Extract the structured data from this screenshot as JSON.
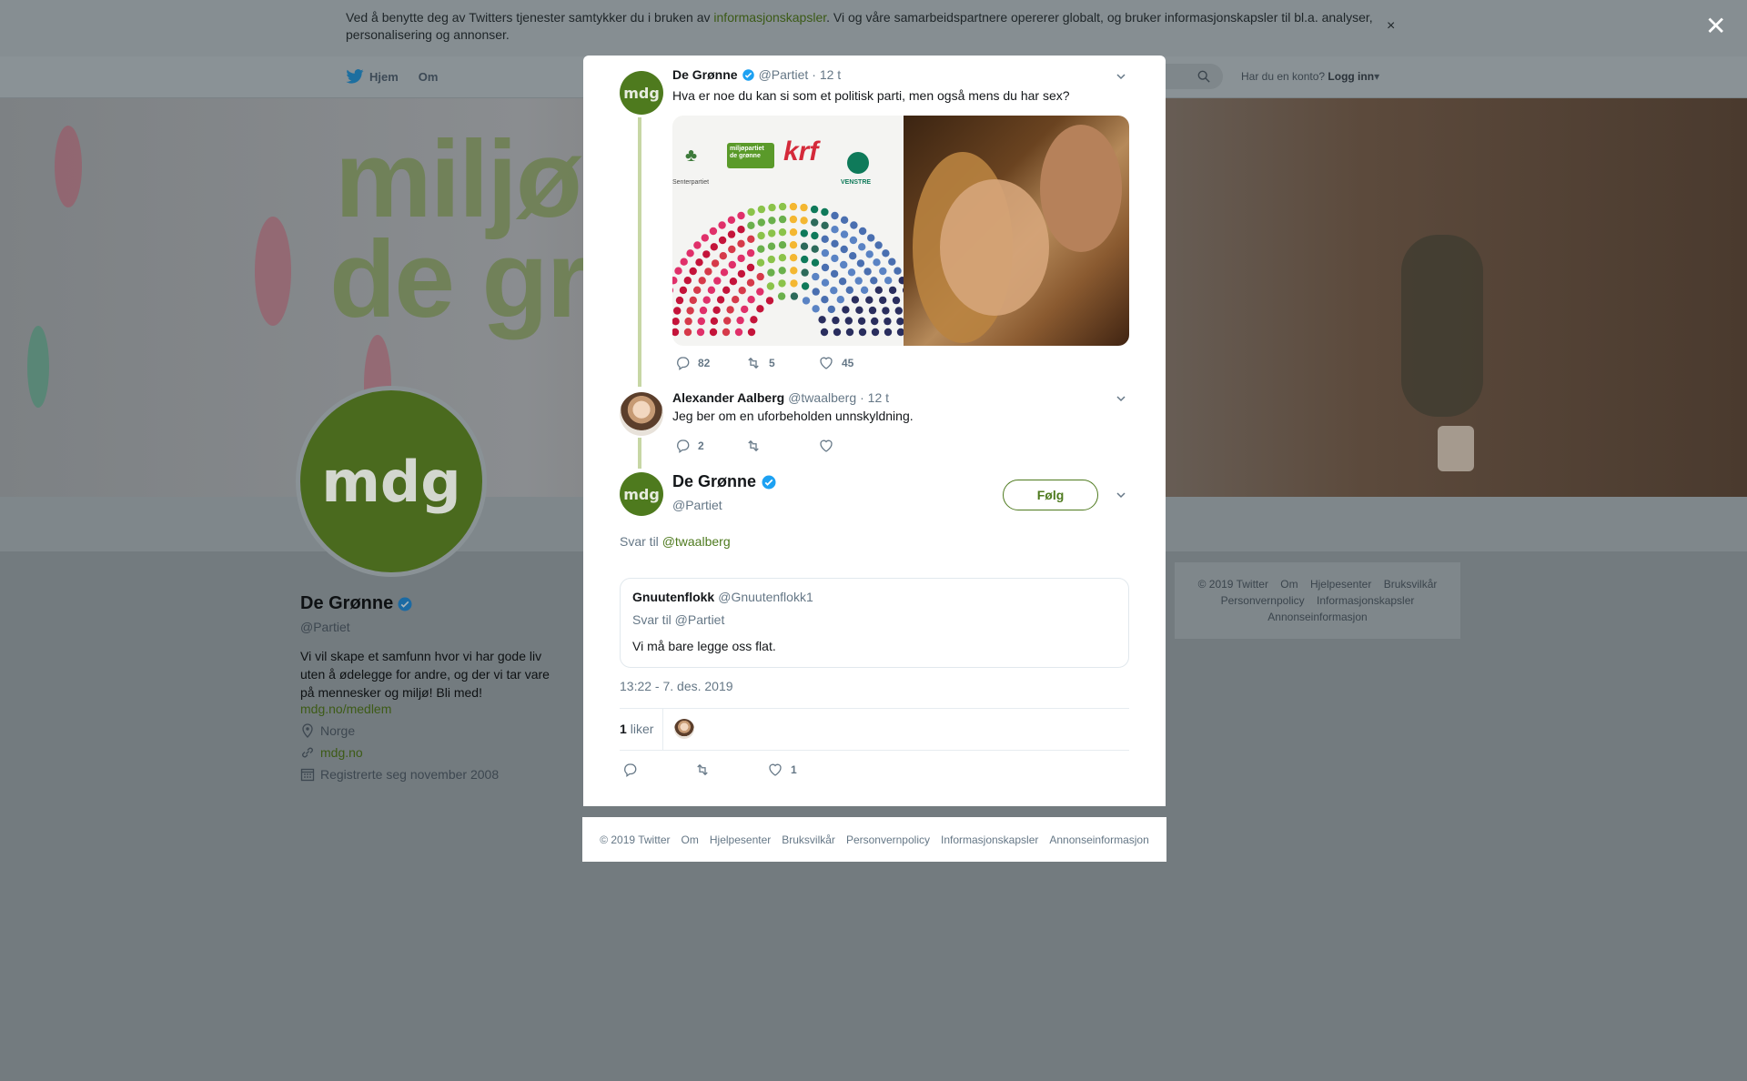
{
  "cookie_bar": {
    "text_before": "Ved å benytte deg av Twitters tjenester samtykker du i bruken av ",
    "link": "informasjonskapsler",
    "text_after": ". Vi og våre samarbeidspartnere opererer globalt, og bruker informasjonskapsler til bl.a. analyser, personalisering og annonser.",
    "close": "×"
  },
  "overlay_close": "✕",
  "topbar": {
    "home": "Hjem",
    "about": "Om",
    "login_prompt": "Har du en konto?",
    "login": "Logg inn"
  },
  "banner": {
    "line1": "miljøpa",
    "line2": "de grø"
  },
  "profile": {
    "avatar_text": "mdg",
    "name": "De Grønne",
    "handle": "@Partiet",
    "bio": "Vi vil skape et samfunn hvor vi har gode liv uten å ødelegge for andre, og der vi tar vare på mennesker og miljø! Bli med!",
    "bio_link": "mdg.no/medlem",
    "location": "Norge",
    "website": "mdg.no",
    "joined": "Registrerte seg november 2008"
  },
  "bg_footer": {
    "items": [
      "© 2019 Twitter",
      "Om",
      "Hjelpesenter",
      "Bruksvilkår",
      "Personvernpolicy",
      "Informasjonskapsler",
      "Annonseinformasjon"
    ]
  },
  "tweet1": {
    "avatar_text": "mdg",
    "name": "De Grønne",
    "handle": "@Partiet",
    "time": "· 12 t",
    "text": "Hva er noe du kan si som et politisk parti, men også mens du har sex?",
    "logos": {
      "sp": "Senterpartiet",
      "mdg": "miljøpartiet de grønne",
      "krf": "krf",
      "v": "VENSTRE"
    },
    "replies": "82",
    "retweets": "5",
    "likes": "45"
  },
  "tweet2": {
    "name": "Alexander Aalberg",
    "handle": "@twaalberg",
    "time": "· 12 t",
    "text": "Jeg ber om en uforbeholden unnskyldning.",
    "replies": "2"
  },
  "main_tweet": {
    "avatar_text": "mdg",
    "name": "De Grønne",
    "handle": "@Partiet",
    "follow": "Følg",
    "reply_prefix": "Svar til",
    "reply_user": "@twaalberg",
    "quote": {
      "name": "Gnuutenflokk",
      "handle": "@Gnuutenflokk1",
      "reply": "Svar til @Partiet",
      "text": "Vi må bare legge oss flat."
    },
    "timestamp": "13:22 - 7. des. 2019",
    "likes_count": "1",
    "likes_label": "liker",
    "action_likes": "1"
  },
  "modal_footer": {
    "items": [
      "© 2019 Twitter",
      "Om",
      "Hjelpesenter",
      "Bruksvilkår",
      "Personvernpolicy",
      "Informasjonskapsler",
      "Annonseinformasjon"
    ]
  },
  "colors": {
    "brand_green": "#4e7a1e",
    "verified": "#1da1f2",
    "muted": "#657786"
  },
  "chart_dots": {
    "rows": [
      [
        "#c4143a",
        "#c4143a",
        "#c4143a",
        "#c4143a",
        "#c4143a",
        "#c4143a",
        "#c4143a",
        "#c4143a",
        "#c4143a",
        "#6ab04c",
        "#6ab04c",
        "#f4b731",
        "#2d6a5a",
        "#2d6a5a",
        "#5a83c4",
        "#5a83c4",
        "#5a83c4",
        "#5a83c4",
        "#2a2e5e",
        "#2a2e5e",
        "#2a2e5e"
      ]
    ]
  }
}
